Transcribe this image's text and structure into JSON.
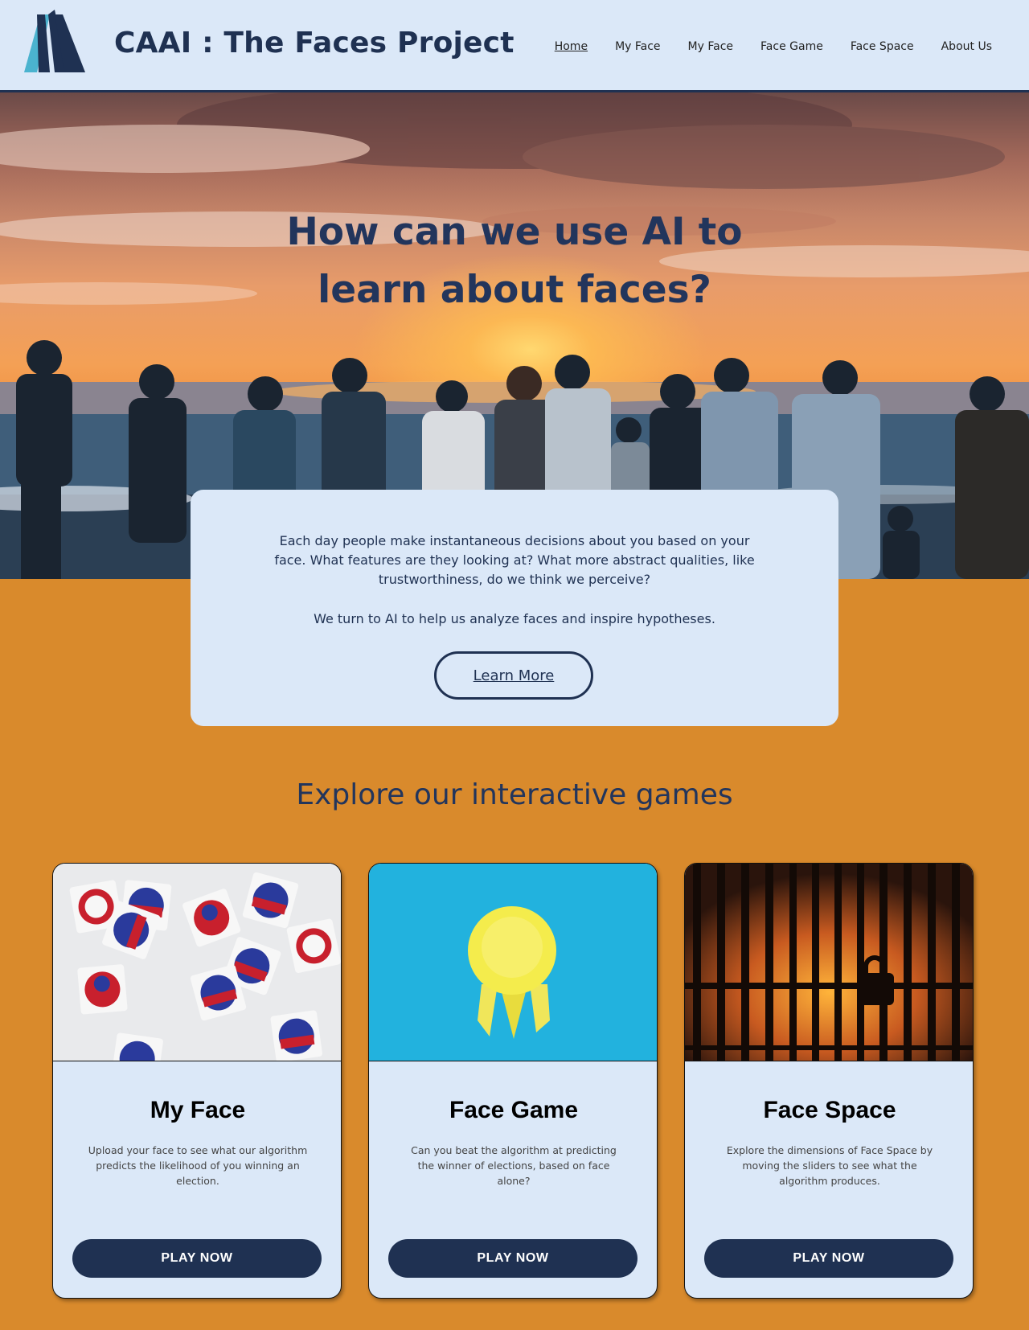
{
  "header": {
    "site_title": "CAAI : The Faces Project",
    "nav": [
      "Home",
      "My Face",
      "My Face",
      "Face Game",
      "Face Space",
      "About Us"
    ],
    "active_nav": "Home"
  },
  "hero": {
    "heading_line1": "How can we use AI to",
    "heading_line2": "learn about faces?"
  },
  "intro": {
    "paragraph1": "Each day people make instantaneous decisions about you based on your face. What features are they looking at? What more abstract qualities, like trustworthiness, do we think we perceive?",
    "paragraph2": "We turn to AI to help us analyze faces and inspire hypotheses.",
    "button_label": "Learn More"
  },
  "games": {
    "heading": "Explore our interactive games",
    "cards": [
      {
        "title": "My Face",
        "description": "Upload your face to see what our algorithm predicts the likelihood of you winning an election.",
        "button_label": "PLAY NOW",
        "image": "i-voted-stickers"
      },
      {
        "title": "Face Game",
        "description": "Can you beat the algorithm at predicting the winner of elections, based on face alone?",
        "button_label": "PLAY NOW",
        "image": "yellow-ribbon-on-blue"
      },
      {
        "title": "Face Space",
        "description": "Explore the dimensions of Face Space by moving the sliders to see what the algorithm produces.",
        "button_label": "PLAY NOW",
        "image": "padlock-on-fence-sunset"
      }
    ]
  },
  "colors": {
    "navy": "#1f3152",
    "light_blue": "#dbe8f8",
    "orange": "#d98a2c"
  }
}
